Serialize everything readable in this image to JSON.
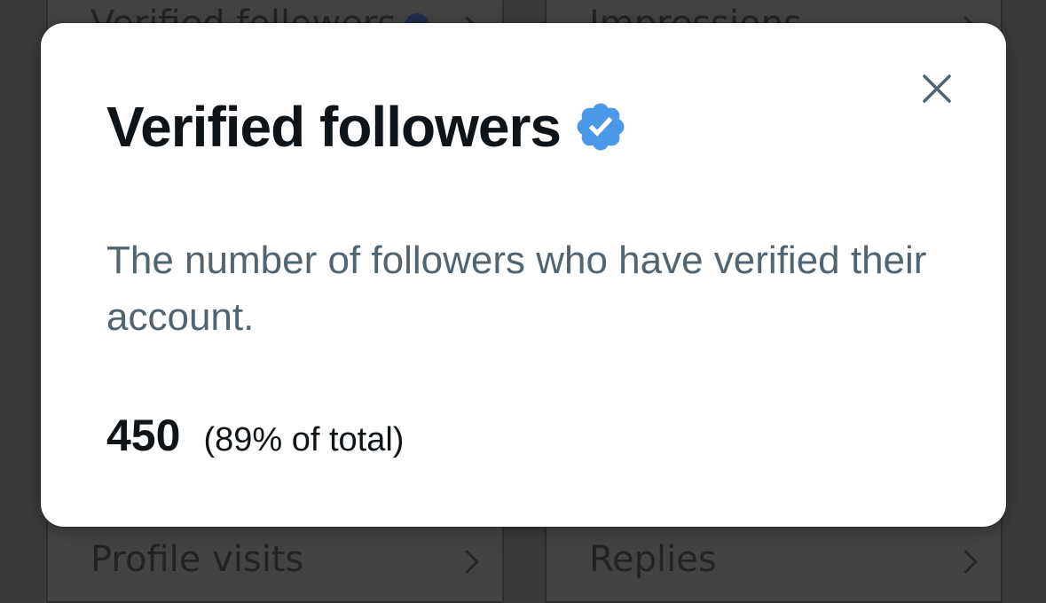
{
  "background_cards": [
    {
      "label": "Verified followers",
      "verified": true
    },
    {
      "label": "Impressions"
    },
    {
      "label": "Profile visits"
    },
    {
      "label": "Replies"
    }
  ],
  "modal": {
    "title": "Verified followers",
    "badge_icon": "verified-badge-icon",
    "badge_color": "#4a98e8",
    "description": "The number of followers who have verified their account.",
    "value": "450",
    "percent_text": "(89% of total)",
    "close_icon": "close-icon"
  }
}
